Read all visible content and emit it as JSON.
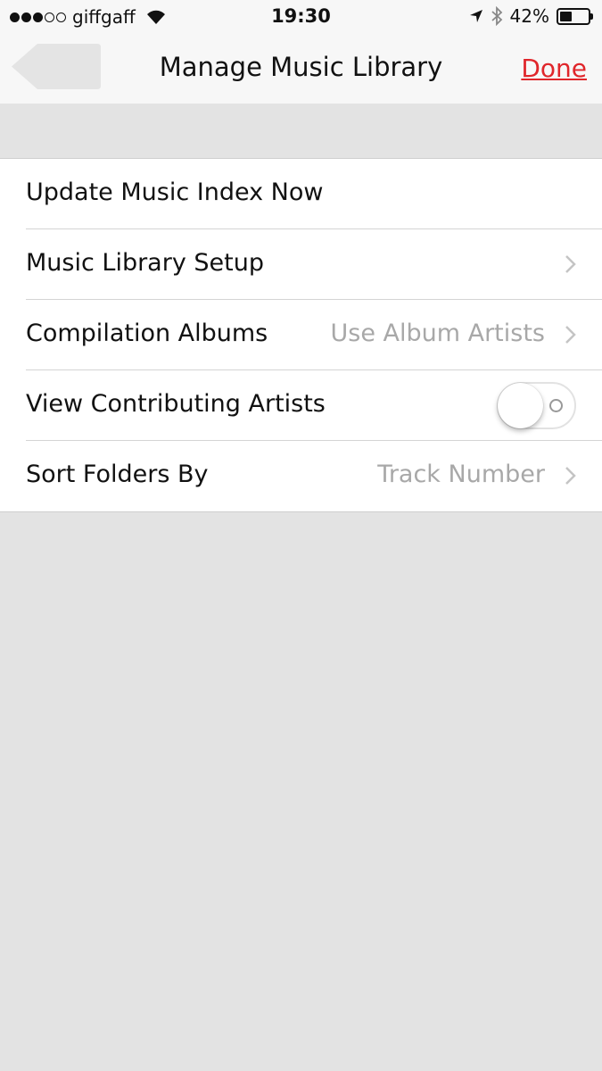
{
  "status_bar": {
    "carrier": "giffgaff",
    "time": "19:30",
    "battery_percent": "42%",
    "battery_level": 0.42,
    "signal_bars_filled": 3,
    "signal_bars_total": 5
  },
  "nav": {
    "title": "Manage Music Library",
    "done_label": "Done",
    "accent_color": "#e0262b"
  },
  "rows": [
    {
      "label": "Update Music Index Now"
    },
    {
      "label": "Music Library Setup"
    },
    {
      "label": "Compilation Albums",
      "value": "Use Album Artists"
    },
    {
      "label": "View Contributing Artists",
      "toggle_on": false
    },
    {
      "label": "Sort Folders By",
      "value": "Track Number"
    }
  ]
}
